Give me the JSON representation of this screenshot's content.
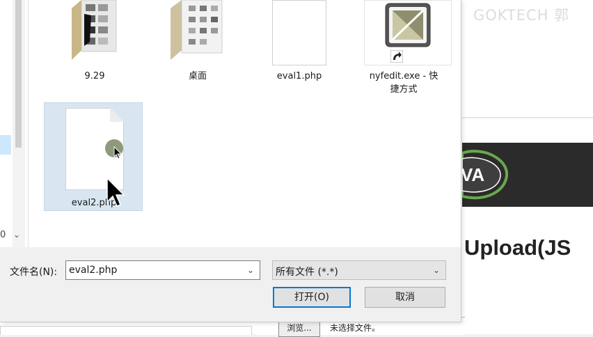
{
  "background_page": {
    "watermark": "GOKTECH 郭",
    "logo_text": "VA",
    "heading": "Upload(JS",
    "browse_button": "浏览...",
    "no_file_text": "未选择文件。"
  },
  "dialog": {
    "files": [
      {
        "name": "9.29",
        "icon": "folder-icon"
      },
      {
        "name": "桌面",
        "icon": "folder-icon"
      },
      {
        "name": "eval1.php",
        "icon": "document-icon"
      },
      {
        "name": "nyfedit.exe - 快捷方式",
        "label_line1": "nyfedit.exe - 快",
        "label_line2": "捷方式",
        "icon": "shortcut-icon"
      },
      {
        "name": "eval2.php",
        "icon": "document-icon",
        "selected": true
      }
    ],
    "nav_partial_text": "0",
    "filename_label": "文件名(N):",
    "filename_value": "eval2.php",
    "filetype_value": "所有文件 (*.*)",
    "open_button": "打开(O)",
    "cancel_button": "取消"
  },
  "colors": {
    "selection": "#d9e6f2",
    "primary_border": "#0078d7",
    "banner": "#2b2b2b"
  }
}
